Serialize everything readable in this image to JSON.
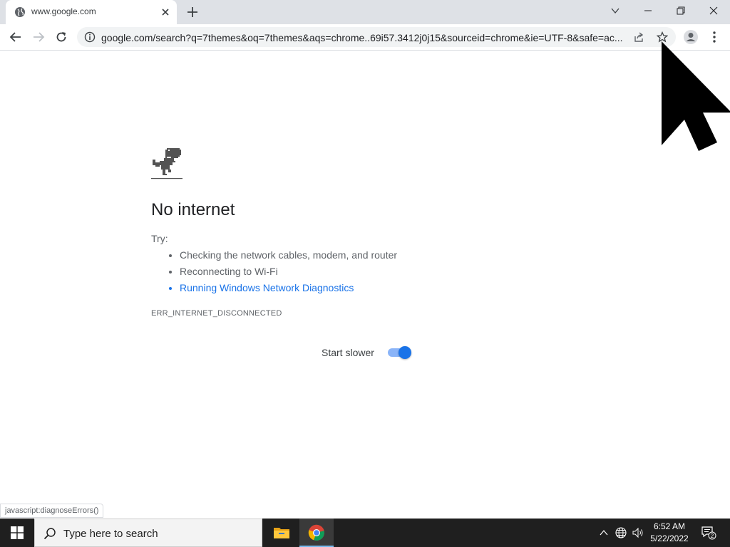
{
  "browser": {
    "tab": {
      "title": "www.google.com",
      "favicon": "globe-icon",
      "close_icon": "close-icon"
    },
    "new_tab_icon": "plus-icon",
    "window_controls": {
      "tab_search": "chevron-down-icon",
      "minimize": "minimize-icon",
      "restore": "restore-icon",
      "close": "close-icon"
    },
    "toolbar": {
      "back_icon": "arrow-left-icon",
      "forward_icon": "arrow-right-icon",
      "reload_icon": "reload-icon",
      "url": "google.com/search?q=7themes&oq=7themes&aqs=chrome..69i57.3412j0j15&sourceid=chrome&ie=UTF-8&safe=ac...",
      "site_info_icon": "info-icon",
      "share_icon": "share-icon",
      "bookmark_icon": "star-icon",
      "profile_icon": "profile-icon",
      "menu_icon": "kebab-menu-icon"
    }
  },
  "error_page": {
    "icon": "dino-icon",
    "heading": "No internet",
    "try_label": "Try:",
    "suggestions": [
      "Checking the network cables, modem, and router",
      "Reconnecting to Wi-Fi",
      "Running Windows Network Diagnostics"
    ],
    "error_code": "ERR_INTERNET_DISCONNECTED",
    "toggle": {
      "label": "Start slower",
      "on": true
    }
  },
  "status_bubble": "javascript:diagnoseErrors()",
  "taskbar": {
    "start_icon": "windows-logo-icon",
    "search_placeholder": "Type here to search",
    "apps": [
      "file-explorer-icon",
      "chrome-icon"
    ],
    "tray_icons": [
      "chevron-up-icon",
      "network-icon",
      "volume-icon"
    ],
    "time": "6:52 AM",
    "date": "5/22/2022",
    "notifications_count": "2"
  },
  "colors": {
    "link": "#1a73e8",
    "taskbar_bg": "#1f1f1f",
    "tabstrip_bg": "#dee1e6"
  }
}
